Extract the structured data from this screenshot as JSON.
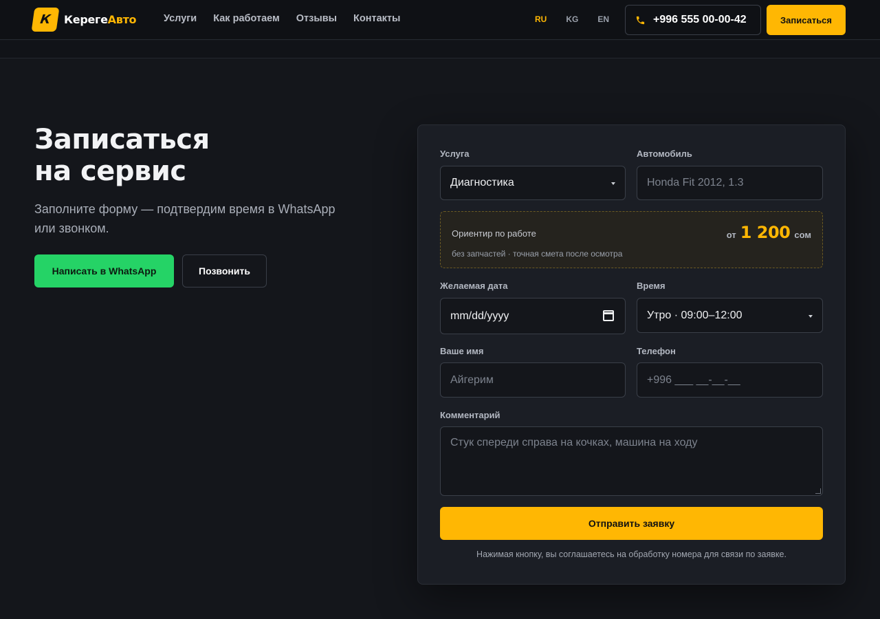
{
  "brand": {
    "logo_letter": "К",
    "name_white": "Кереге",
    "name_accent": "Авто",
    "accent_color": "#ffb703"
  },
  "nav": {
    "items": [
      "Услуги",
      "Как работаем",
      "Отзывы",
      "Контакты"
    ]
  },
  "languages": {
    "items": [
      "RU",
      "KG",
      "EN"
    ],
    "active": "RU"
  },
  "header": {
    "phone": "+996 555 00-00-42",
    "phone_icon": "phone-icon",
    "book_label": "Записаться"
  },
  "hero": {
    "title_line1": "Записаться",
    "title_line2": "на сервис",
    "subtitle": "Заполните форму — подтвердим время в WhatsApp или звонком.",
    "whatsapp_label": "Написать в WhatsApp",
    "whatsapp_color": "#25d366",
    "call_label": "Позвонить"
  },
  "form": {
    "service": {
      "label": "Услуга",
      "value": "Диагностика"
    },
    "car": {
      "label": "Автомобиль",
      "placeholder": "Honda Fit 2012, 1.3"
    },
    "estimate": {
      "title": "Ориентир по работе",
      "prefix": "от",
      "price": "1 200",
      "currency": "сом",
      "note": "без запчастей · точная смета после осмотра"
    },
    "date": {
      "label": "Желаемая дата",
      "placeholder": "mm/dd/yyyy"
    },
    "time": {
      "label": "Время",
      "value": "Утро · 09:00–12:00"
    },
    "name": {
      "label": "Ваше имя",
      "placeholder": "Айгерим"
    },
    "phone": {
      "label": "Телефон",
      "placeholder": "+996 ___ __-__-__"
    },
    "comment": {
      "label": "Комментарий",
      "placeholder": "Стук спереди справа на кочках, машина на ходу"
    },
    "submit_label": "Отправить заявку",
    "consent": "Нажимая кнопку, вы соглашаетесь на обработку номера для связи по заявке."
  }
}
